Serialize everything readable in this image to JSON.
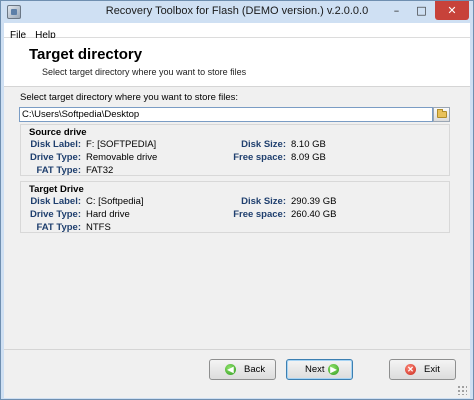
{
  "window": {
    "title": "Recovery Toolbox for Flash (DEMO version.) v.2.0.0.0",
    "min_glyph": "–",
    "max_glyph": "□",
    "close_glyph": "✕"
  },
  "menu": {
    "items": [
      "File",
      "Help"
    ]
  },
  "header": {
    "title": "Target directory",
    "subtitle": "Select target directory where you want to store files"
  },
  "path": {
    "label": "Select target directory where you want to store files:",
    "value": "C:\\Users\\Softpedia\\Desktop"
  },
  "source_drive": {
    "title": "Source drive",
    "disk_label_label": "Disk Label:",
    "disk_label": "F: [SOFTPEDIA]",
    "drive_type_label": "Drive Type:",
    "drive_type": "Removable drive",
    "fat_type_label": "FAT Type:",
    "fat_type": "FAT32",
    "disk_size_label": "Disk Size:",
    "disk_size": "8.10 GB",
    "free_space_label": "Free space:",
    "free_space": "8.09 GB"
  },
  "target_drive": {
    "title": "Target Drive",
    "disk_label_label": "Disk Label:",
    "disk_label": "C: [Softpedia]",
    "drive_type_label": "Drive Type:",
    "drive_type": "Hard drive",
    "fat_type_label": "FAT Type:",
    "fat_type": "NTFS",
    "disk_size_label": "Disk Size:",
    "disk_size": "290.39 GB",
    "free_space_label": "Free space:",
    "free_space": "260.40 GB"
  },
  "buttons": {
    "back": "Back",
    "next": "Next",
    "exit": "Exit"
  },
  "colors": {
    "window_frame": "#cfe0f3",
    "close_button": "#c7423a",
    "field_label": "#1f3f6e"
  }
}
